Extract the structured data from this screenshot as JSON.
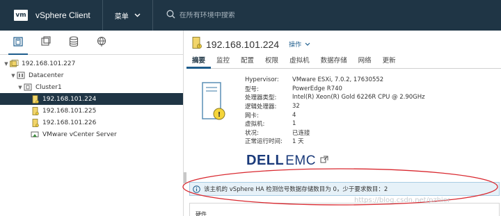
{
  "topbar": {
    "logo_text": "vm",
    "app_title": "vSphere Client",
    "menu_label": "菜单",
    "search_placeholder": "在所有环境中搜索"
  },
  "left_tabs": [
    {
      "name": "hosts-and-clusters",
      "icon": "hosts-clusters-icon",
      "active": true
    },
    {
      "name": "vms-and-templates",
      "icon": "vms-templates-icon",
      "active": false
    },
    {
      "name": "storage",
      "icon": "storage-icon",
      "active": false
    },
    {
      "name": "networking",
      "icon": "network-icon",
      "active": false
    }
  ],
  "tree": {
    "vcenter": "192.168.101.227",
    "datacenter": "Datacenter",
    "cluster": "Cluster1",
    "hosts": [
      "192.168.101.224",
      "192.168.101.225",
      "192.168.101.226"
    ],
    "vm": "VMware vCenter Server",
    "selected": "192.168.101.224"
  },
  "host_header": {
    "title": "192.168.101.224",
    "actions_label": "操作"
  },
  "tabs": [
    "摘要",
    "监控",
    "配置",
    "权限",
    "虚拟机",
    "数据存储",
    "网络",
    "更新"
  ],
  "summary": {
    "properties": [
      {
        "key": "Hypervisor:",
        "value": "VMware ESXi, 7.0.2, 17630552"
      },
      {
        "key": "型号:",
        "value": "PowerEdge R740"
      },
      {
        "key": "处理器类型:",
        "value": "Intel(R) Xeon(R) Gold 6226R CPU @ 2.90GHz"
      },
      {
        "key": "逻辑处理器:",
        "value": "32"
      },
      {
        "key": "网卡:",
        "value": "4"
      },
      {
        "key": "虚拟机:",
        "value": "1"
      },
      {
        "key": "状况:",
        "value": "已连接"
      },
      {
        "key": "正常运行时间:",
        "value": "1 天"
      }
    ],
    "brand_dell": "DELL",
    "brand_emc": "EMC"
  },
  "alert": {
    "text": "该主机的 vSphere HA 检测信号数据存储数目为 0，少于要求数目：2"
  },
  "hardware_card": {
    "label": "硬件"
  },
  "watermark": "https://blog.csdn.net/pzhier",
  "colors": {
    "topbar_bg": "#1f3545",
    "accent": "#1d5c8c",
    "alert_bg": "#e6f1f8",
    "annotation": "#d9282f"
  }
}
